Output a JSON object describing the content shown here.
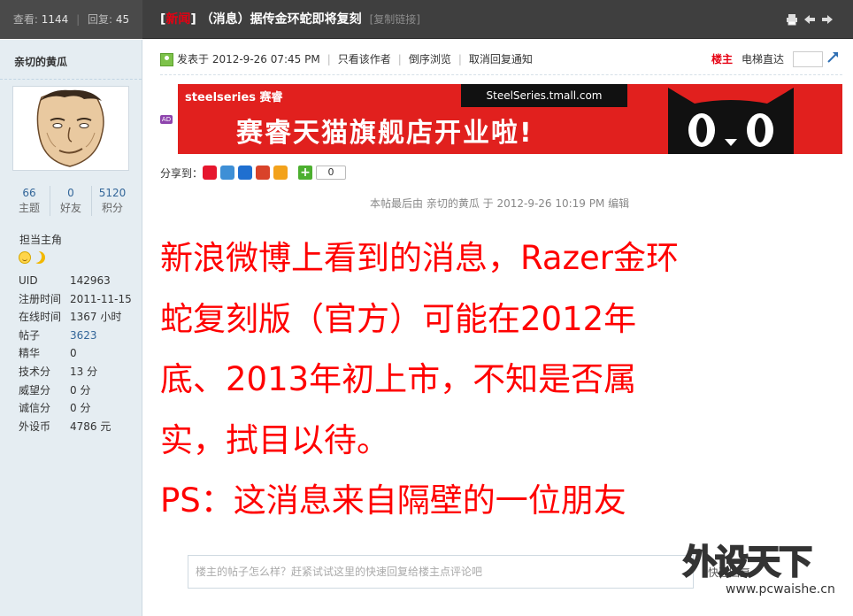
{
  "topbar": {
    "views_label": "查看:",
    "views": "1144",
    "replies_label": "回复:",
    "replies": "45",
    "tag_open": "[",
    "tag": "新闻",
    "tag_close": "]",
    "title": "（消息）据传金环蛇即将复刻",
    "copy_link": "[复制链接]",
    "icons": [
      "print-icon",
      "prev-thread-icon",
      "next-thread-icon"
    ]
  },
  "sidebar": {
    "author": "亲切的黄瓜",
    "counts": [
      {
        "value": "66",
        "label": "主题"
      },
      {
        "value": "0",
        "label": "好友"
      },
      {
        "value": "5120",
        "label": "积分"
      }
    ],
    "role": "担当主角",
    "info": [
      {
        "key": "UID",
        "value": "142963"
      },
      {
        "key": "注册时间",
        "value": "2011-11-15"
      },
      {
        "key": "在线时间",
        "value": "1367 小时"
      },
      {
        "key": "帖子",
        "value": "3623"
      },
      {
        "key": "精华",
        "value": "0"
      },
      {
        "key": "技术分",
        "value": "13 分"
      },
      {
        "key": "威望分",
        "value": "0 分"
      },
      {
        "key": "诚信分",
        "value": "0 分"
      },
      {
        "key": "外设币",
        "value": "4786 元"
      }
    ]
  },
  "post_meta": {
    "posted": "发表于 2012-9-26 07:45 PM",
    "author_only": "只看该作者",
    "reverse": "倒序浏览",
    "cancel_notify": "取消回复通知",
    "floor": "楼主",
    "jump_label": "电梯直达"
  },
  "banner": {
    "ad_tag": "AD",
    "brand": "steelseries 赛睿",
    "url": "SteelSeries.tmall.com",
    "slogan": "赛睿天猫旗舰店开业啦!"
  },
  "share": {
    "label": "分享到：",
    "count": "0",
    "icons": [
      {
        "name": "weibo-share-icon",
        "color": "#e6162d"
      },
      {
        "name": "qzone-share-icon",
        "color": "#3e8fd6"
      },
      {
        "name": "renren-share-icon",
        "color": "#1f6fd0"
      },
      {
        "name": "kaixin-share-icon",
        "color": "#d9432a"
      },
      {
        "name": "pengyou-share-icon",
        "color": "#f3a21b"
      }
    ]
  },
  "edited": "本帖最后由 亲切的黄瓜 于 2012-9-26 10:19 PM 编辑",
  "body": {
    "lines": [
      "新浪微博上看到的消息，Razer金环",
      "蛇复刻版（官方）可能在2012年",
      "底、2013年初上市，不知是否属",
      "实，拭目以待。",
      "PS：这消息来自隔壁的一位朋友"
    ],
    "color": "#ff0000"
  },
  "quick_reply": {
    "placeholder": "楼主的帖子怎么样？赶紧试试这里的快速回复给楼主点评论吧",
    "button": "快速回复"
  },
  "watermark": {
    "title": "外设天下",
    "url": "www.pcwaishe.cn"
  }
}
